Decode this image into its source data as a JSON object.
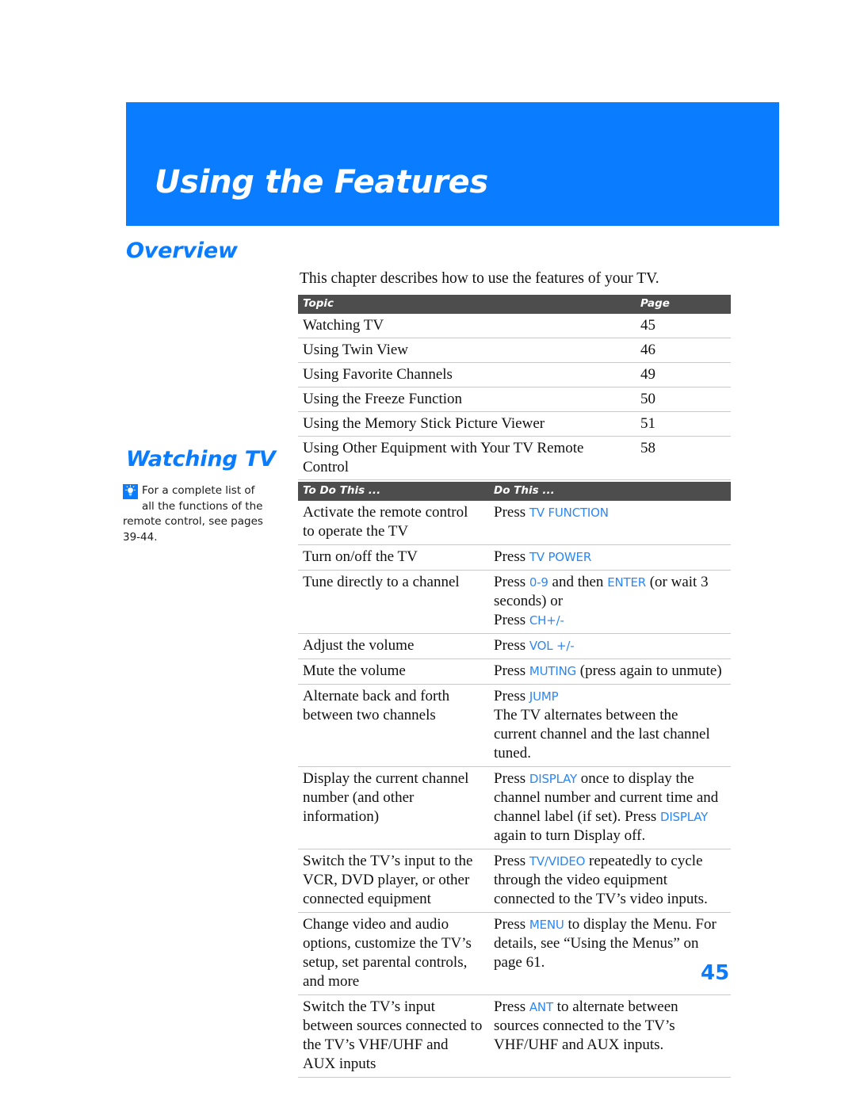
{
  "page": {
    "chapter_title": "Using the Features",
    "page_number": "45",
    "banner_color": "#0a7cff",
    "accent_color": "#0a7cff",
    "keyword_color": "#2b87f5",
    "table_header_color": "#4d4d4d"
  },
  "overview": {
    "heading": "Overview",
    "intro": "This chapter describes how to use the features of your TV.",
    "table": {
      "columns": [
        "Topic",
        "Page"
      ],
      "rows": [
        {
          "topic": "Watching TV",
          "page": "45"
        },
        {
          "topic": "Using Twin View",
          "page": "46"
        },
        {
          "topic": "Using Favorite Channels",
          "page": "49"
        },
        {
          "topic": "Using the Freeze Function",
          "page": "50"
        },
        {
          "topic": "Using the Memory Stick Picture Viewer",
          "page": "51"
        },
        {
          "topic": "Using Other Equipment with Your TV Remote Control",
          "page": "58"
        }
      ]
    }
  },
  "watching_tv": {
    "heading": "Watching TV",
    "note": {
      "icon": "tip-lightbulb-icon",
      "text": "For a complete list of all the functions of the remote control, see pages 39-44."
    },
    "table": {
      "columns": [
        "To Do This ...",
        "Do This ..."
      ],
      "rows": [
        {
          "todo": "Activate the remote control to operate the TV",
          "do_parts": [
            {
              "t": "Press ",
              "kw": false
            },
            {
              "t": "TV FUNCTION",
              "kw": true
            }
          ]
        },
        {
          "todo": "Turn on/off the TV",
          "do_parts": [
            {
              "t": "Press ",
              "kw": false
            },
            {
              "t": "TV POWER",
              "kw": true
            }
          ]
        },
        {
          "todo": "Tune directly to a channel",
          "do_parts": [
            {
              "t": "Press ",
              "kw": false
            },
            {
              "t": "0-9",
              "kw": true
            },
            {
              "t": " and then ",
              "kw": false
            },
            {
              "t": "ENTER",
              "kw": true
            },
            {
              "t": " (or wait 3 seconds) or",
              "kw": false
            },
            {
              "t": "\n",
              "kw": false
            },
            {
              "t": "Press ",
              "kw": false
            },
            {
              "t": "CH+/-",
              "kw": true
            }
          ]
        },
        {
          "todo": "Adjust the volume",
          "do_parts": [
            {
              "t": "Press ",
              "kw": false
            },
            {
              "t": "VOL +/-",
              "kw": true
            }
          ]
        },
        {
          "todo": "Mute the volume",
          "do_parts": [
            {
              "t": "Press ",
              "kw": false
            },
            {
              "t": "MUTING",
              "kw": true
            },
            {
              "t": " (press again to unmute)",
              "kw": false
            }
          ]
        },
        {
          "todo": "Alternate back and forth between two channels",
          "do_parts": [
            {
              "t": "Press ",
              "kw": false
            },
            {
              "t": "JUMP",
              "kw": true
            },
            {
              "t": "\n",
              "kw": false
            },
            {
              "t": "The TV alternates between the current channel and the last channel tuned.",
              "kw": false
            }
          ]
        },
        {
          "todo": "Display the current channel number (and other information)",
          "do_parts": [
            {
              "t": "Press ",
              "kw": false
            },
            {
              "t": "DISPLAY",
              "kw": true
            },
            {
              "t": " once to display the channel number and current time and channel label (if set). Press ",
              "kw": false
            },
            {
              "t": "DISPLAY",
              "kw": true
            },
            {
              "t": " again to turn Display off.",
              "kw": false
            }
          ]
        },
        {
          "todo": "Switch the TV’s input to the VCR, DVD player, or other connected equipment",
          "do_parts": [
            {
              "t": "Press ",
              "kw": false
            },
            {
              "t": "TV/VIDEO",
              "kw": true
            },
            {
              "t": " repeatedly to cycle through the video equipment connected to the TV’s video inputs.",
              "kw": false
            }
          ]
        },
        {
          "todo": "Change video and audio options, customize the TV’s setup, set parental controls, and more",
          "do_parts": [
            {
              "t": "Press ",
              "kw": false
            },
            {
              "t": "MENU",
              "kw": true
            },
            {
              "t": " to display the Menu. For details, see “Using the Menus” on page 61.",
              "kw": false
            }
          ]
        },
        {
          "todo": "Switch the TV’s input between sources connected to the TV’s VHF/UHF and AUX inputs",
          "do_parts": [
            {
              "t": "Press ",
              "kw": false
            },
            {
              "t": "ANT",
              "kw": true
            },
            {
              "t": " to alternate between sources connected to the TV’s VHF/UHF and AUX inputs.",
              "kw": false
            }
          ]
        }
      ]
    }
  }
}
